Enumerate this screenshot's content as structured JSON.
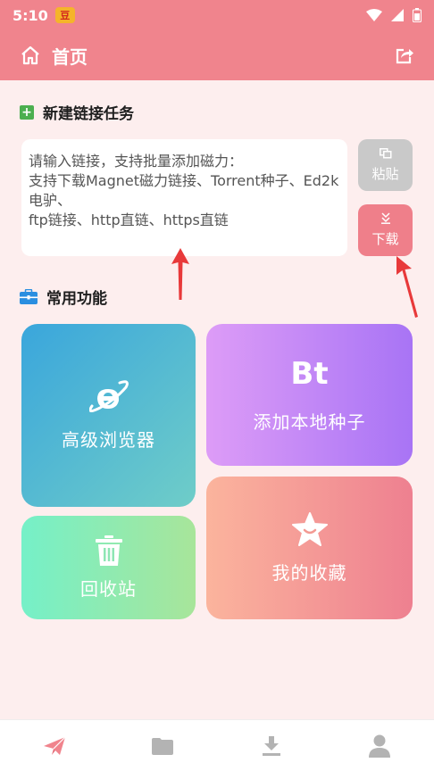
{
  "status_bar": {
    "time": "5:10",
    "app_badge": "豆"
  },
  "app_bar": {
    "title": "首页"
  },
  "new_task": {
    "heading": "新建链接任务",
    "input_lines": [
      "请输入链接，支持批量添加磁力：",
      "",
      "支持下载Magnet磁力链接、Torrent种子、Ed2k电驴、",
      "ftp链接、http直链、https直链"
    ],
    "paste_label": "粘贴",
    "download_label": "下载"
  },
  "functions": {
    "heading": "常用功能",
    "browser_label": "高级浏览器",
    "bt_icon_text": "Bt",
    "bt_label": "添加本地种子",
    "recycle_label": "回收站",
    "favorites_label": "我的收藏"
  },
  "colors": {
    "accent": "#f0848d",
    "background": "#fdeeee",
    "annotation_arrow": "#e8393a"
  },
  "icons": {
    "home": "home-icon",
    "share": "share-icon",
    "nav": [
      "send-icon",
      "folder-icon",
      "download-icon",
      "user-icon"
    ]
  }
}
